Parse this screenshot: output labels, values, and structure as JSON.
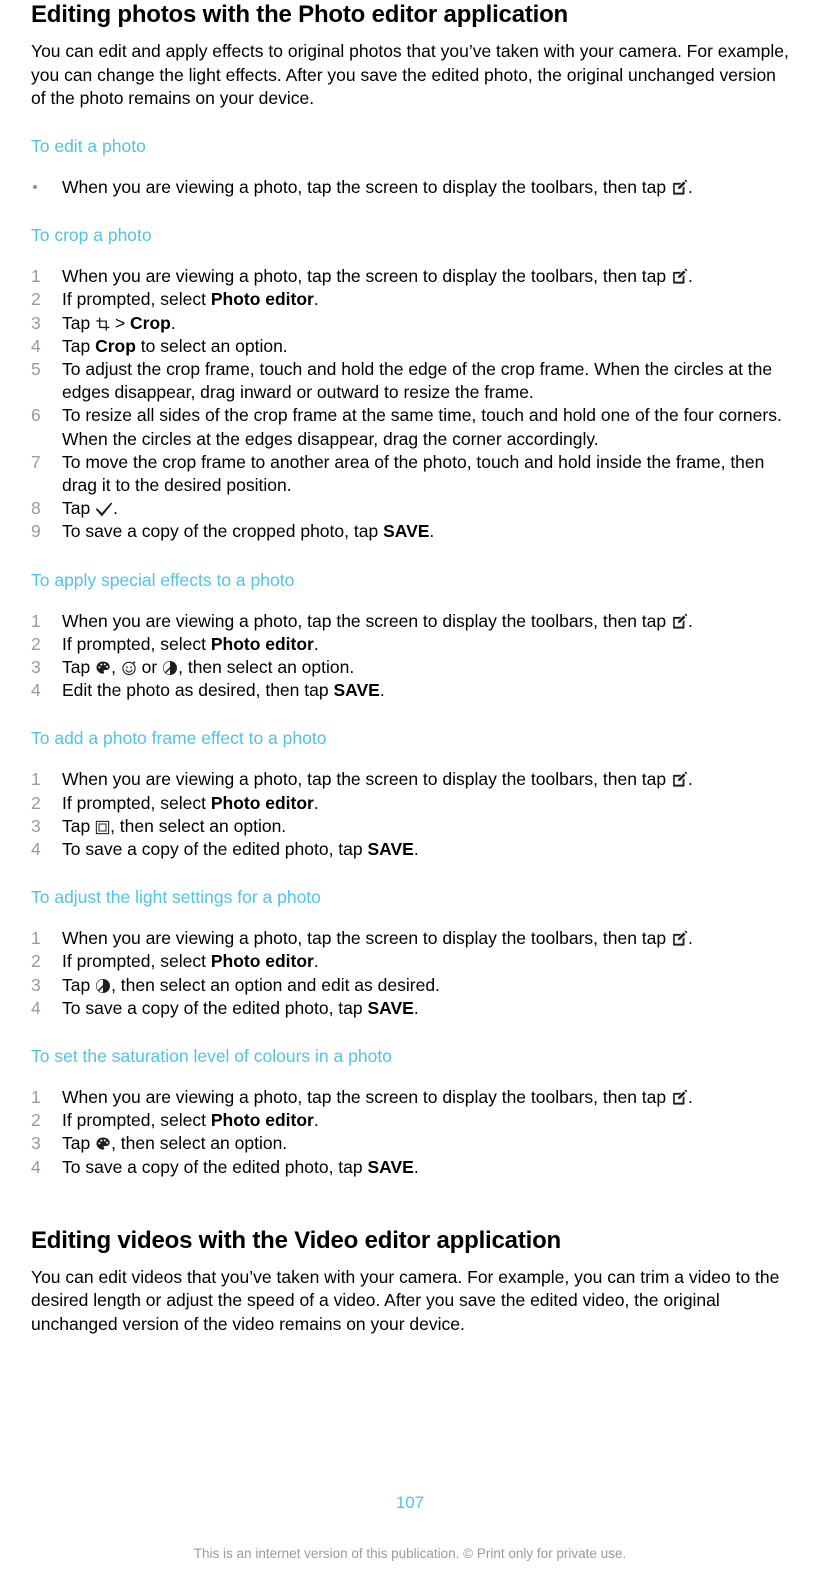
{
  "document": {
    "page_number": "107",
    "disclaimer": "This is an internet version of this publication. © Print only for private use.",
    "heading_color": "#4FC3E8",
    "body_color": "#000000",
    "marker_color": "#9a9a9a"
  },
  "sections": [
    {
      "title": "Editing photos with the Photo editor application",
      "intro": "You can edit and apply effects to original photos that you’ve taken with your camera. For example, you can change the light effects. After you save the edited photo, the original unchanged version of the photo remains on your device.",
      "procedures": [
        {
          "heading": "To edit a photo",
          "list_type": "bullet",
          "steps": [
            {
              "parts": [
                {
                  "type": "text",
                  "value": "When you are viewing a photo, tap the screen to display the toolbars, then tap "
                },
                {
                  "type": "icon",
                  "name": "edit-icon"
                },
                {
                  "type": "text",
                  "value": "."
                }
              ]
            }
          ]
        },
        {
          "heading": "To crop a photo",
          "list_type": "number",
          "steps": [
            {
              "parts": [
                {
                  "type": "text",
                  "value": "When you are viewing a photo, tap the screen to display the toolbars, then tap "
                },
                {
                  "type": "icon",
                  "name": "edit-icon"
                },
                {
                  "type": "text",
                  "value": "."
                }
              ]
            },
            {
              "parts": [
                {
                  "type": "text",
                  "value": "If prompted, select "
                },
                {
                  "type": "bold",
                  "value": "Photo editor"
                },
                {
                  "type": "text",
                  "value": "."
                }
              ]
            },
            {
              "parts": [
                {
                  "type": "text",
                  "value": "Tap "
                },
                {
                  "type": "icon",
                  "name": "crop-tool-icon"
                },
                {
                  "type": "text",
                  "value": " > "
                },
                {
                  "type": "bold",
                  "value": "Crop"
                },
                {
                  "type": "text",
                  "value": "."
                }
              ]
            },
            {
              "parts": [
                {
                  "type": "text",
                  "value": "Tap "
                },
                {
                  "type": "bold",
                  "value": "Crop"
                },
                {
                  "type": "text",
                  "value": " to select an option."
                }
              ]
            },
            {
              "parts": [
                {
                  "type": "text",
                  "value": "To adjust the crop frame, touch and hold the edge of the crop frame. When the circles at the edges disappear, drag inward or outward to resize the frame."
                }
              ]
            },
            {
              "parts": [
                {
                  "type": "text",
                  "value": "To resize all sides of the crop frame at the same time, touch and hold one of the four corners. When the circles at the edges disappear, drag the corner accordingly."
                }
              ]
            },
            {
              "parts": [
                {
                  "type": "text",
                  "value": "To move the crop frame to another area of the photo, touch and hold inside the frame, then drag it to the desired position."
                }
              ]
            },
            {
              "parts": [
                {
                  "type": "text",
                  "value": "Tap "
                },
                {
                  "type": "icon",
                  "name": "checkmark-icon"
                },
                {
                  "type": "text",
                  "value": "."
                }
              ]
            },
            {
              "parts": [
                {
                  "type": "text",
                  "value": "To save a copy of the cropped photo, tap "
                },
                {
                  "type": "bold",
                  "value": "SAVE"
                },
                {
                  "type": "text",
                  "value": "."
                }
              ]
            }
          ]
        },
        {
          "heading": "To apply special effects to a photo",
          "list_type": "number",
          "steps": [
            {
              "parts": [
                {
                  "type": "text",
                  "value": "When you are viewing a photo, tap the screen to display the toolbars, then tap "
                },
                {
                  "type": "icon",
                  "name": "edit-icon"
                },
                {
                  "type": "text",
                  "value": "."
                }
              ]
            },
            {
              "parts": [
                {
                  "type": "text",
                  "value": "If prompted, select "
                },
                {
                  "type": "bold",
                  "value": "Photo editor"
                },
                {
                  "type": "text",
                  "value": "."
                }
              ]
            },
            {
              "parts": [
                {
                  "type": "text",
                  "value": "Tap "
                },
                {
                  "type": "icon",
                  "name": "palette-icon"
                },
                {
                  "type": "text",
                  "value": ", "
                },
                {
                  "type": "icon",
                  "name": "sparkle-effects-icon"
                },
                {
                  "type": "text",
                  "value": " or "
                },
                {
                  "type": "icon",
                  "name": "contrast-icon"
                },
                {
                  "type": "text",
                  "value": ", then select an option."
                }
              ]
            },
            {
              "parts": [
                {
                  "type": "text",
                  "value": "Edit the photo as desired, then tap "
                },
                {
                  "type": "bold",
                  "value": "SAVE"
                },
                {
                  "type": "text",
                  "value": "."
                }
              ]
            }
          ]
        },
        {
          "heading": "To add a photo frame effect to a photo",
          "list_type": "number",
          "steps": [
            {
              "parts": [
                {
                  "type": "text",
                  "value": "When you are viewing a photo, tap the screen to display the toolbars, then tap "
                },
                {
                  "type": "icon",
                  "name": "edit-icon"
                },
                {
                  "type": "text",
                  "value": "."
                }
              ]
            },
            {
              "parts": [
                {
                  "type": "text",
                  "value": "If prompted, select "
                },
                {
                  "type": "bold",
                  "value": "Photo editor"
                },
                {
                  "type": "text",
                  "value": "."
                }
              ]
            },
            {
              "parts": [
                {
                  "type": "text",
                  "value": "Tap "
                },
                {
                  "type": "icon",
                  "name": "photo-frame-icon"
                },
                {
                  "type": "text",
                  "value": ", then select an option."
                }
              ]
            },
            {
              "parts": [
                {
                  "type": "text",
                  "value": "To save a copy of the edited photo, tap "
                },
                {
                  "type": "bold",
                  "value": "SAVE"
                },
                {
                  "type": "text",
                  "value": "."
                }
              ]
            }
          ]
        },
        {
          "heading": "To adjust the light settings for a photo",
          "list_type": "number",
          "steps": [
            {
              "parts": [
                {
                  "type": "text",
                  "value": "When you are viewing a photo, tap the screen to display the toolbars, then tap "
                },
                {
                  "type": "icon",
                  "name": "edit-icon"
                },
                {
                  "type": "text",
                  "value": "."
                }
              ]
            },
            {
              "parts": [
                {
                  "type": "text",
                  "value": "If prompted, select "
                },
                {
                  "type": "bold",
                  "value": "Photo editor"
                },
                {
                  "type": "text",
                  "value": "."
                }
              ]
            },
            {
              "parts": [
                {
                  "type": "text",
                  "value": "Tap "
                },
                {
                  "type": "icon",
                  "name": "contrast-icon"
                },
                {
                  "type": "text",
                  "value": ", then select an option and edit as desired."
                }
              ]
            },
            {
              "parts": [
                {
                  "type": "text",
                  "value": "To save a copy of the edited photo, tap "
                },
                {
                  "type": "bold",
                  "value": "SAVE"
                },
                {
                  "type": "text",
                  "value": "."
                }
              ]
            }
          ]
        },
        {
          "heading": "To set the saturation level of colours in a photo",
          "list_type": "number",
          "steps": [
            {
              "parts": [
                {
                  "type": "text",
                  "value": "When you are viewing a photo, tap the screen to display the toolbars, then tap "
                },
                {
                  "type": "icon",
                  "name": "edit-icon"
                },
                {
                  "type": "text",
                  "value": "."
                }
              ]
            },
            {
              "parts": [
                {
                  "type": "text",
                  "value": "If prompted, select "
                },
                {
                  "type": "bold",
                  "value": "Photo editor"
                },
                {
                  "type": "text",
                  "value": "."
                }
              ]
            },
            {
              "parts": [
                {
                  "type": "text",
                  "value": "Tap "
                },
                {
                  "type": "icon",
                  "name": "palette-icon"
                },
                {
                  "type": "text",
                  "value": ", then select an option."
                }
              ]
            },
            {
              "parts": [
                {
                  "type": "text",
                  "value": "To save a copy of the edited photo, tap "
                },
                {
                  "type": "bold",
                  "value": "SAVE"
                },
                {
                  "type": "text",
                  "value": "."
                }
              ]
            }
          ]
        }
      ]
    },
    {
      "title": "Editing videos with the Video editor application",
      "intro": "You can edit videos that you’ve taken with your camera. For example, you can trim a video to the desired length or adjust the speed of a video. After you save the edited video, the original unchanged version of the video remains on your device.",
      "procedures": []
    }
  ]
}
